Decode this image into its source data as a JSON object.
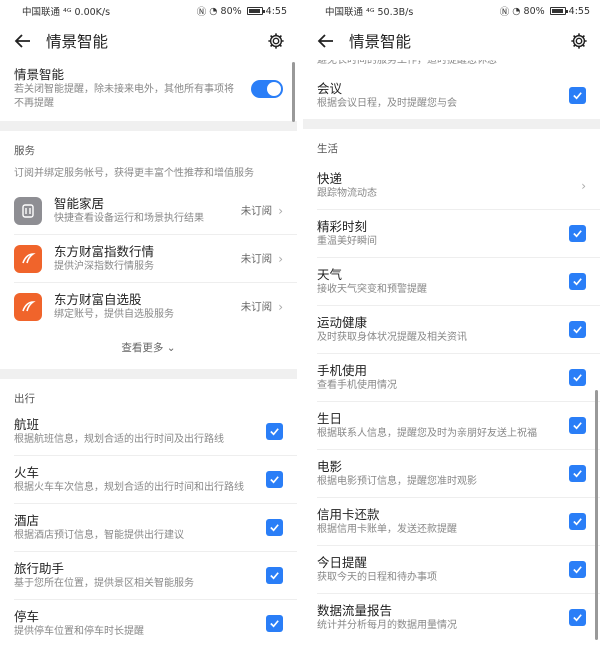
{
  "left": {
    "status": {
      "carrier": "中国联通",
      "speed": "0.00K/s",
      "battery": "80%",
      "time": "4:55"
    },
    "title": "情景智能",
    "master": {
      "label": "情景智能",
      "desc": "若关闭智能提醒，除未接来电外，其他所有事项将不再提醒"
    },
    "services": {
      "title": "服务",
      "desc": "订阅并绑定服务帐号，获得更丰富个性推荐和增值服务",
      "items": [
        {
          "name": "智能家居",
          "desc": "快捷查看设备运行和场景执行结果",
          "state": "未订阅"
        },
        {
          "name": "东方财富指数行情",
          "desc": "提供沪深指数行情服务",
          "state": "未订阅"
        },
        {
          "name": "东方财富自选股",
          "desc": "绑定账号，提供自选股服务",
          "state": "未订阅"
        }
      ],
      "more": "查看更多"
    },
    "travel": {
      "title": "出行",
      "items": [
        {
          "name": "航班",
          "desc": "根据航班信息，规划合适的出行时间及出行路线"
        },
        {
          "name": "火车",
          "desc": "根据火车车次信息，规划合适的出行时间和出行路线"
        },
        {
          "name": "酒店",
          "desc": "根据酒店预订信息，智能提供出行建议"
        },
        {
          "name": "旅行助手",
          "desc": "基于您所在位置，提供景区相关智能服务"
        },
        {
          "name": "停车",
          "desc": "提供停车位置和停车时长提醒"
        }
      ]
    }
  },
  "right": {
    "status": {
      "carrier": "中国联通",
      "speed": "50.3B/s",
      "battery": "80%",
      "time": "4:55"
    },
    "title": "情景智能",
    "top_partial": "避免长时间的服务工作，适时提醒您休息",
    "meeting": {
      "name": "会议",
      "desc": "根据会议日程，及时提醒您与会"
    },
    "life": {
      "title": "生活",
      "express": {
        "name": "快递",
        "desc": "跟踪物流动态"
      },
      "items": [
        {
          "name": "精彩时刻",
          "desc": "重温美好瞬间"
        },
        {
          "name": "天气",
          "desc": "接收天气突变和预警提醒"
        },
        {
          "name": "运动健康",
          "desc": "及时获取身体状况提醒及相关资讯"
        },
        {
          "name": "手机使用",
          "desc": "查看手机使用情况"
        },
        {
          "name": "生日",
          "desc": "根据联系人信息，提醒您及时为亲朋好友送上祝福"
        },
        {
          "name": "电影",
          "desc": "根据电影预订信息，提醒您准时观影"
        },
        {
          "name": "信用卡还款",
          "desc": "根据信用卡账单，发送还款提醒"
        },
        {
          "name": "今日提醒",
          "desc": "获取今天的日程和待办事项"
        },
        {
          "name": "数据流量报告",
          "desc": "统计并分析每月的数据用量情况"
        }
      ]
    }
  },
  "colors": {
    "accent": "#2a7ef7"
  }
}
